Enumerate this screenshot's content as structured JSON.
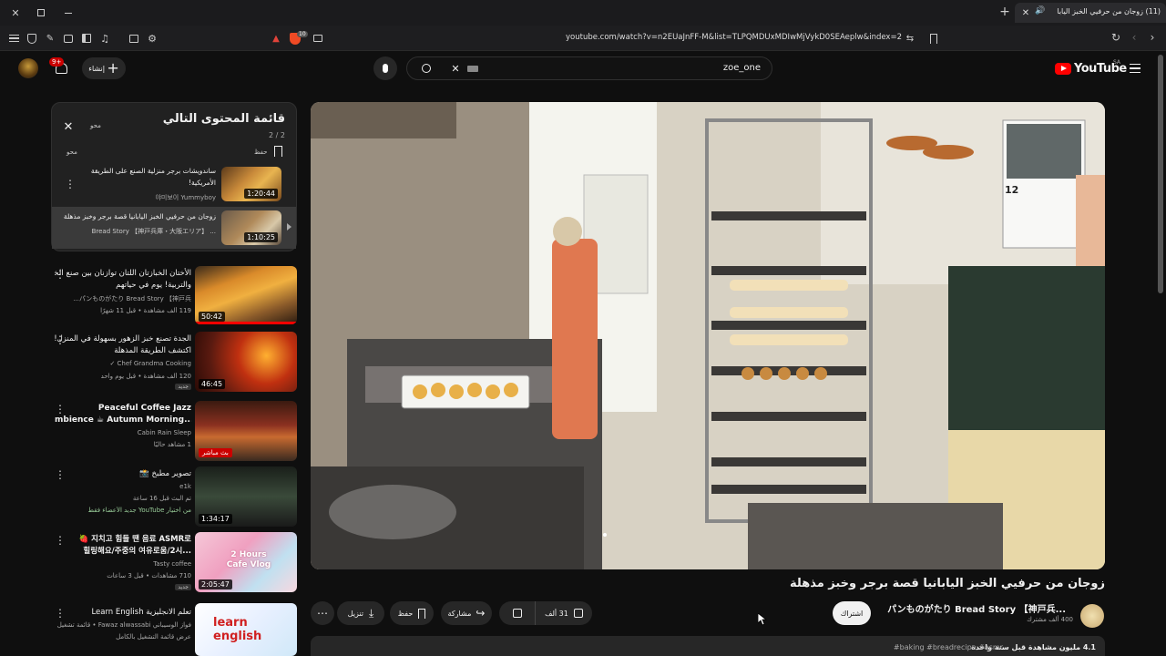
{
  "browser": {
    "tab_title": "(11) زوجان من حرفيي الخبز اليابا",
    "url": "youtube.com/watch?v=n2EUaJnFF-M&list=TLPQMDUxMDIwMjVykD0SEAeplw&index=2",
    "shield_count": "10"
  },
  "header": {
    "logo_text": "YouTube",
    "region": "SA",
    "search_value": "zoe_one",
    "create_label": "إنشاء",
    "notif_count": "9+"
  },
  "queue": {
    "title": "قائمة المحتوى التالي",
    "position": "2 / 2",
    "clear_top": "محو",
    "save_label": "حفظ",
    "clear_label": "محو",
    "items": [
      {
        "title1": "ساندويشات برجر منزلية الصنع على الطريقة",
        "title2": "الأمريكية!",
        "channel": "야미보이 Yummyboy",
        "duration": "1:20:44"
      },
      {
        "title1": "زوجان من حرفيي الخبز اليابانيا قصة برجر وخبز مذهلة",
        "channel": "Bread Story 【神戸兵庫・大阪エリア】 ...",
        "duration": "1:10:25"
      }
    ]
  },
  "related": [
    {
      "title1": "الأختان الخبازتان اللتان توازنان بين صنع الخبز",
      "title2": "والتربية! يوم في حياتهم",
      "channel": "パンものがたり Bread Story 【神戸兵...",
      "meta": "119 ألف مشاهدة • قبل 11 شهرًا",
      "duration": "50:42",
      "badge": ""
    },
    {
      "title1": "الجدة تصنع خبز الزهور بسهولة في المنزل!",
      "title2": "اكتشف الطريقة المذهلة",
      "channel": "Chef Grandma Cooking ✓",
      "meta": "120 ألف مشاهدة • قبل يوم واحد",
      "duration": "46:45",
      "badge": "جديد"
    },
    {
      "title1": "Peaceful Coffee Jazz",
      "title2": "mbience ☕ Autumn Morning...",
      "channel": "Cabin Rain Sleep",
      "meta": "1 مشاهد حاليًا",
      "duration": "",
      "badge": "بث مباشر"
    },
    {
      "title1": "تصوير مطبخ 📸",
      "title2": "",
      "channel": "e1k",
      "meta": "تم البث قبل 16 ساعة",
      "meta2": "من اختيار YouTube  جديد  الأعضاء فقط",
      "duration": "1:34:17",
      "badge": ""
    },
    {
      "title1": "🍓 지치고 힘들 땐 음료 ASMR로",
      "title2": "힐링해요/주중의 여유로움/2시...",
      "channel": "Tasty coffee",
      "meta": "710 مشاهدات • قبل 3 ساعات",
      "duration": "2:05:47",
      "badge": "جديد",
      "thumb_text": "2 Hours Cafe Vlog"
    },
    {
      "title1": "تعلم الانجليزية Learn English",
      "title2": "",
      "channel": "فواز الوسيباني Fawaz alwassabi • قائمة تشغيل",
      "meta": "عرض قائمة التشغيل بالكامل",
      "duration": "",
      "badge": "",
      "thumb_text": "learn english"
    }
  ],
  "video": {
    "title": "زوجان من حرفيي الخبز اليابانيا قصة برجر وخبز مذهلة",
    "channel": "パンものがたり Bread Story 【神戸兵...",
    "subscribers": "400 ألف مشترك",
    "subscribe_label": "اشتراك",
    "likes": "31 ألف",
    "share_label": "مشاركة",
    "save_label": "حفظ",
    "download_label": "تنزيل",
    "description_meta": "4.1 مليون مشاهدة  قبل سنة واحدة",
    "hashtags": "#baking #breadrecipe #asmr",
    "calendar_month": "12"
  },
  "colors": {
    "bg": "#0f0f0f",
    "youtube_red": "#ff0000",
    "pill": "#272727"
  }
}
